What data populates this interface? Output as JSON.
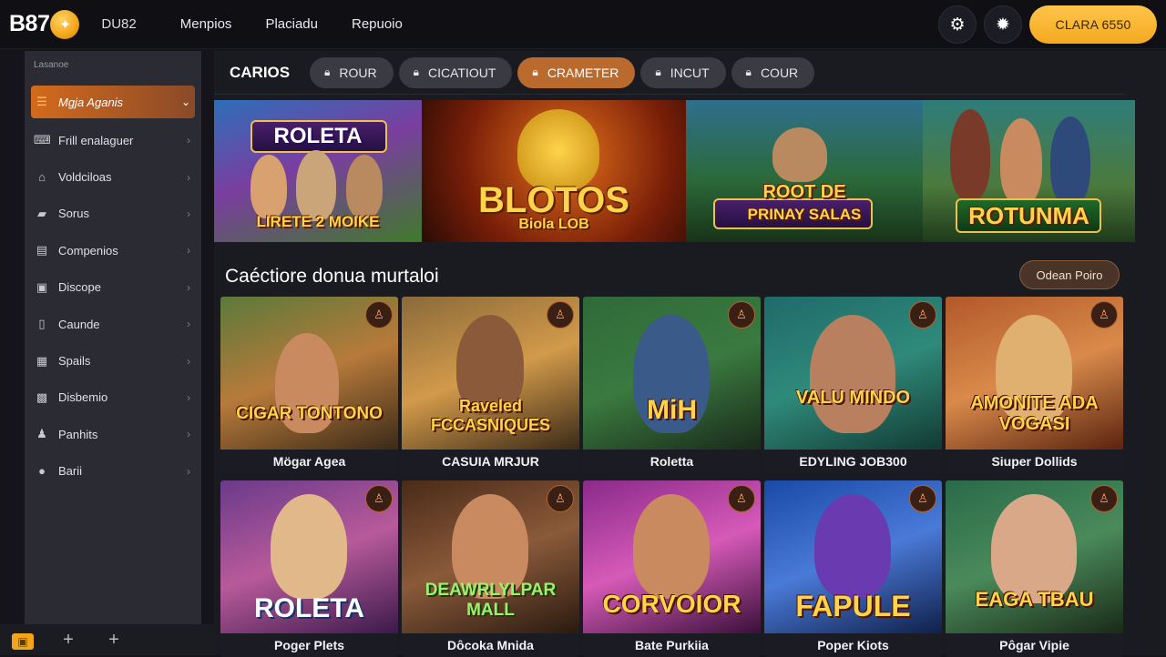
{
  "header": {
    "logo_text": "B87",
    "brand_sub": "DU82",
    "nav": [
      "Menpios",
      "Placiadu",
      "Repuoio"
    ],
    "cta_label": "CLARA 6550"
  },
  "sidebar": {
    "title": "Lasanoe",
    "items": [
      {
        "label": "Mgja Aganis",
        "icon": "list-icon"
      },
      {
        "label": "Frill enalaguer",
        "icon": "chat-icon"
      },
      {
        "label": "Voldciloas",
        "icon": "house-icon"
      },
      {
        "label": "Sorus",
        "icon": "briefcase-icon"
      },
      {
        "label": "Compenios",
        "icon": "table-icon"
      },
      {
        "label": "Discope",
        "icon": "document-icon"
      },
      {
        "label": "Caunde",
        "icon": "file-icon"
      },
      {
        "label": "Spails",
        "icon": "clipboard-icon"
      },
      {
        "label": "Disbemio",
        "icon": "calendar-icon"
      },
      {
        "label": "Panhits",
        "icon": "user-icon"
      },
      {
        "label": "Barii",
        "icon": "circle-icon"
      }
    ]
  },
  "categories": {
    "title": "CARIOS",
    "chips": [
      "ROUR",
      "CICATIOUT",
      "CRAMETER",
      "INCUT",
      "COUR"
    ]
  },
  "banners": [
    {
      "line1": "ROLETA",
      "line2": "LIRETE 2 MOIKE"
    },
    {
      "line1": "BLOTOS",
      "line2": "Biola LOB"
    },
    {
      "line1": "ROOT DE",
      "line2": "PRINAY SALAS"
    },
    {
      "line1": "ROTUNMA"
    }
  ],
  "section": {
    "title": "Caéctiore donua murtaloi",
    "see_all": "Odean Poiro"
  },
  "games": [
    {
      "art": "CIGAR TONTONO",
      "name": "Mögar Agea"
    },
    {
      "art": "Raveled FCCASNIQUES",
      "name": "CASUIA MRJUR"
    },
    {
      "art": "MiH",
      "name": "Roletta"
    },
    {
      "art": "VALU MINDO",
      "name": "EDYLING JOB300"
    },
    {
      "art": "AMONITE ADA VOGASI",
      "name": "Siuper Dollids"
    },
    {
      "art": "ROLETA",
      "name": "Poger Plets"
    },
    {
      "art": "DEAWRLYLPAR MALL",
      "name": "Dôcoka Mnida"
    },
    {
      "art": "CORVOIOR",
      "name": "Bate Purkiia"
    },
    {
      "art": "FAPULE",
      "name": "Poper Kiots"
    },
    {
      "art": "EAGA TBAU",
      "name": "Pôgar Vipie"
    }
  ]
}
